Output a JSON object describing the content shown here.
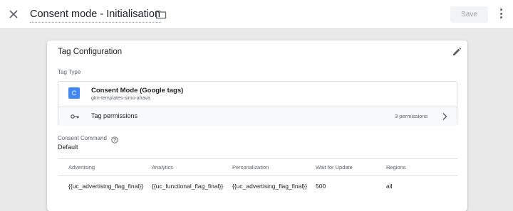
{
  "header": {
    "title": "Consent mode - Initialisation",
    "save_label": "Save",
    "icons": {
      "close": "close-icon",
      "folder": "folder-icon",
      "more": "more-vert-icon"
    }
  },
  "card": {
    "title": "Tag Configuration",
    "edit_icon": "pencil-icon",
    "tag_type_label": "Tag Type",
    "tag_type": {
      "icon_letter": "C",
      "name": "Consent Mode (Google tags)",
      "source": "gtm-templates-simo-ahava"
    },
    "permissions": {
      "label": "Tag permissions",
      "count": "3 permissions",
      "icon": "key-icon"
    },
    "consent_command_label": "Consent Command",
    "consent_command_value": "Default",
    "table": {
      "headers": [
        "Advertising",
        "Analytics",
        "Personalization",
        "Wait for Update",
        "Regions"
      ],
      "rows": [
        [
          "{{uc_advertising_flag_final}}",
          "{{uc_functional_flag_final}}",
          "{{uc_advertising_flag_final}}",
          "500",
          "all"
        ]
      ]
    }
  },
  "colors": {
    "accent": "#4285f4",
    "background": "#e9e9e9",
    "card": "#ffffff"
  }
}
